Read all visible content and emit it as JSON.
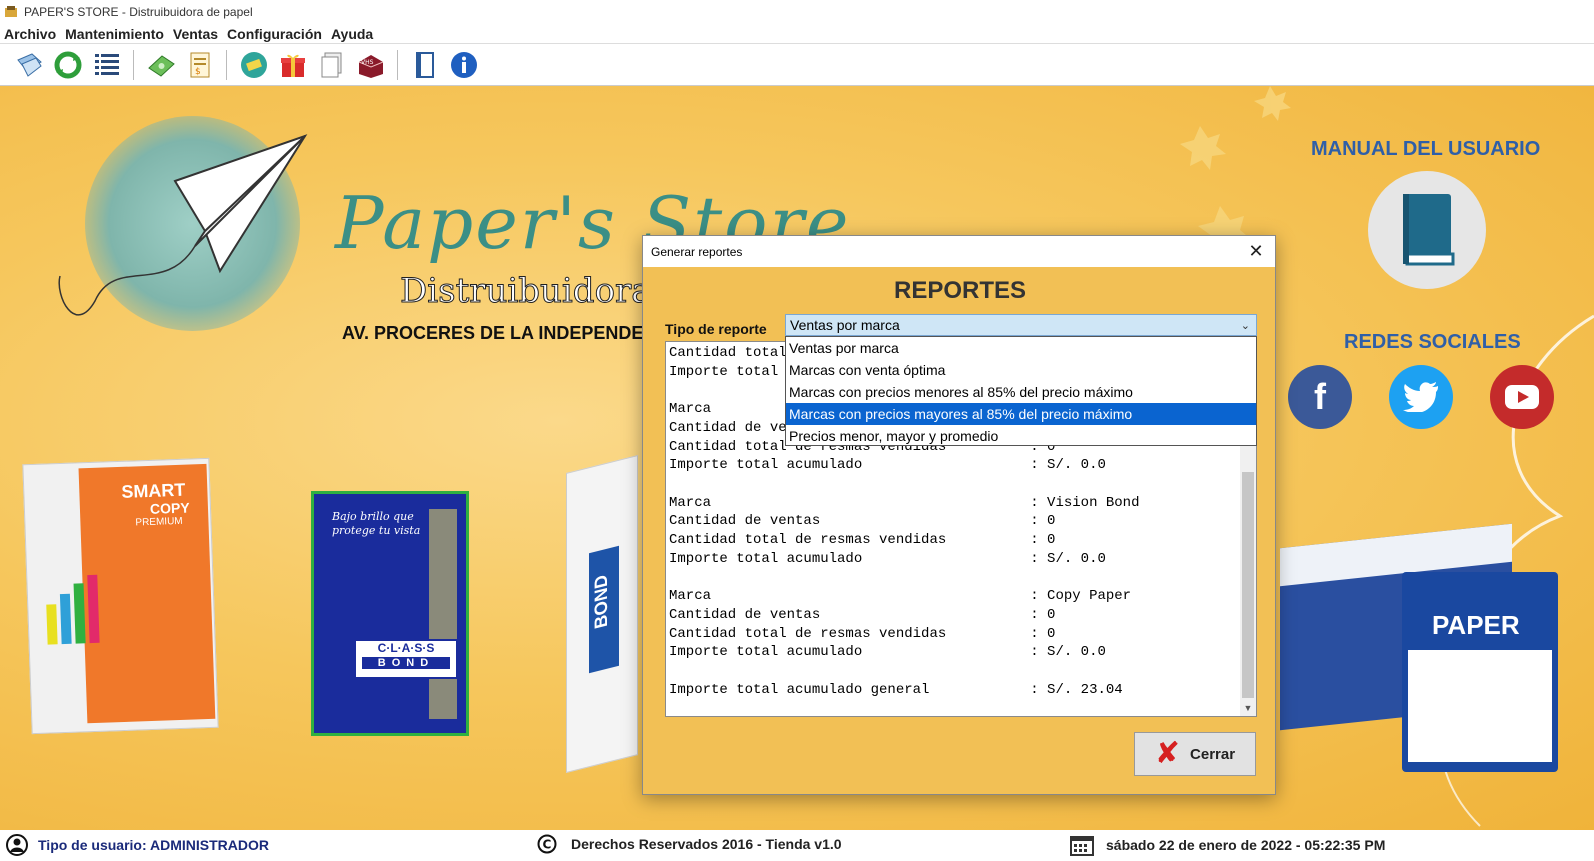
{
  "window": {
    "title": "PAPER'S STORE - Distruibuidora de papel"
  },
  "menu": [
    "Archivo",
    "Mantenimiento",
    "Ventas",
    "Configuración",
    "Ayuda"
  ],
  "toolbar_icons": [
    "users-icon",
    "refresh-icon",
    "list-icon",
    "money-icon",
    "invoice-icon",
    "ticket-icon",
    "gift-icon",
    "documents-icon",
    "store-icon",
    "book-icon",
    "info-icon"
  ],
  "background": {
    "brand_name": "Paper's Store",
    "brand_subtitle": "Distruibuidora d",
    "address": "AV. PROCERES DE LA INDEPENDE",
    "manual_heading": "MANUAL DEL USUARIO",
    "social_heading": "REDES SOCIALES",
    "products": {
      "smart_brand": "SMART",
      "smart_line": "COPY",
      "smart_edition": "PREMIUM",
      "class_tagline": "Bajo brillo que protege tu vista",
      "class_name": "C·L·A·S·S",
      "class_bond": "BOND",
      "bond_name": "BOND",
      "copy_paper": "PAPER"
    }
  },
  "status": {
    "user_type": "Tipo de usuario: ADMINISTRADOR",
    "rights": "Derechos Reservados 2016 - Tienda v1.0",
    "datetime": "sábado 22 de enero de 2022 - 05:22:35 PM"
  },
  "dialog": {
    "title": "Generar reportes",
    "close_glyph": "✕",
    "heading": "REPORTES",
    "type_label": "Tipo de reporte",
    "selected_type": "Ventas por marca",
    "options": [
      "Ventas por marca",
      "Marcas con venta óptima",
      "Marcas con precios menores al 85% del precio máximo",
      "Marcas con precios mayores al 85% del precio máximo",
      "Precios menor, mayor y promedio"
    ],
    "highlighted_option_index": 3,
    "report_lines": [
      "Cantidad total",
      "Importe total a",
      "",
      "Marca",
      "Cantidad de ven",
      "Cantidad total de resmas vendidas          : 0",
      "Importe total acumulado                    : S/. 0.0",
      "",
      "Marca                                      : Vision Bond",
      "Cantidad de ventas                         : 0",
      "Cantidad total de resmas vendidas          : 0",
      "Importe total acumulado                    : S/. 0.0",
      "",
      "Marca                                      : Copy Paper",
      "Cantidad de ventas                         : 0",
      "Cantidad total de resmas vendidas          : 0",
      "Importe total acumulado                    : S/. 0.0",
      "",
      "Importe total acumulado general            : S/. 23.04"
    ],
    "close_button": "Cerrar"
  }
}
